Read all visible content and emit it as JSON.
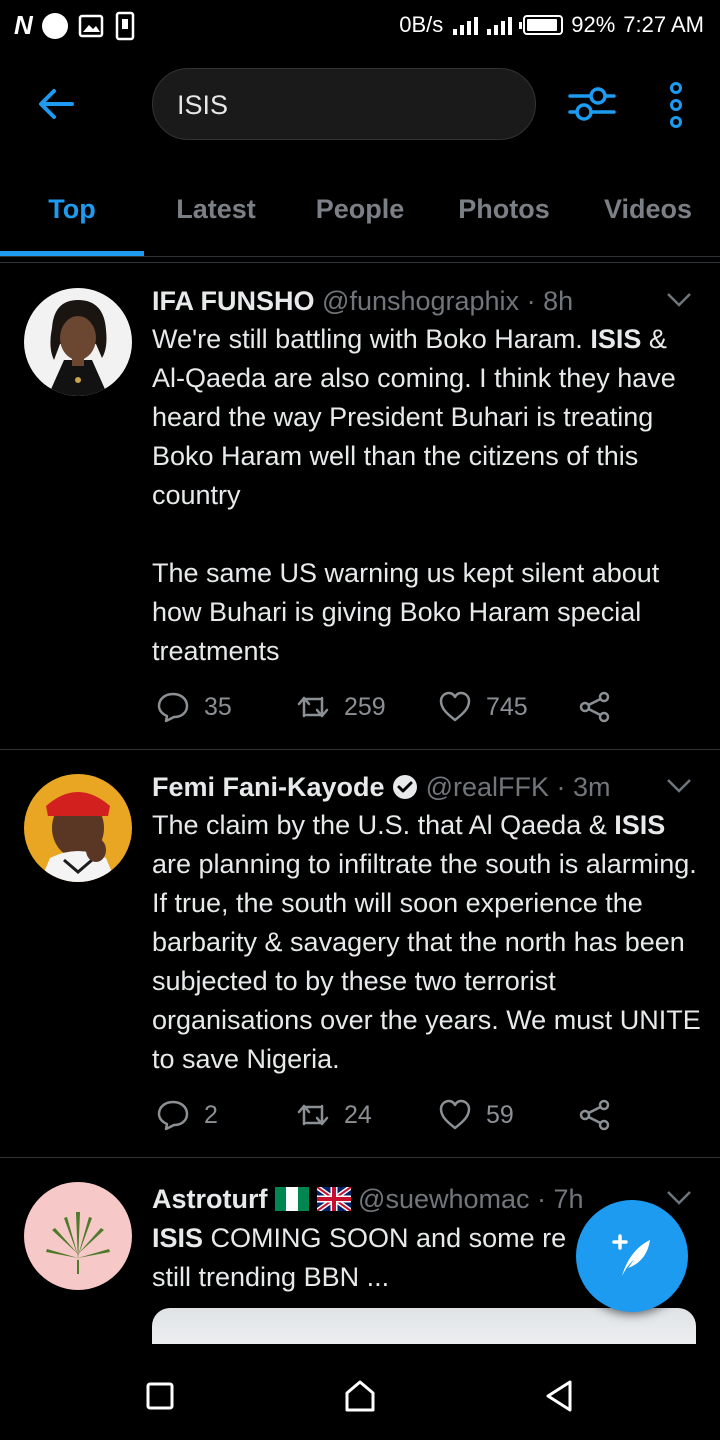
{
  "status_bar": {
    "net_speed": "0B/s",
    "battery": "92%",
    "time": "7:27 AM"
  },
  "search": {
    "query": "ISIS"
  },
  "tabs": [
    {
      "label": "Top",
      "active": true
    },
    {
      "label": "Latest",
      "active": false
    },
    {
      "label": "People",
      "active": false
    },
    {
      "label": "Photos",
      "active": false
    },
    {
      "label": "Videos",
      "active": false
    }
  ],
  "tweets": [
    {
      "name": "IFA FUNSHO",
      "handle": "@funshographix",
      "time": "· 8h",
      "body": [
        [
          "We're still battling with Boko Haram. ",
          "ISIS",
          " & Al-Qaeda are also coming. I think they have heard the way President Buhari is treating Boko Haram well than the citizens of this country"
        ],
        [
          "The same US warning us kept silent about how Buhari is giving Boko Haram special treatments"
        ]
      ],
      "replies": "35",
      "retweets": "259",
      "likes": "745"
    },
    {
      "name": "Femi Fani-Kayode",
      "verified": true,
      "handle": "@realFFK",
      "time": "· 3m",
      "body": [
        [
          "The claim by the U.S. that Al Qaeda & ",
          "ISIS",
          " are planning to infiltrate  the south is alarming. If true, the south will soon experience the barbarity & savagery that the north has been subjected to by these two terrorist organisations over the years. We must UNITE to save Nigeria."
        ]
      ],
      "replies": "2",
      "retweets": "24",
      "likes": "59"
    },
    {
      "name": "Astroturf",
      "handle": "@suewhomac",
      "time": "· 7h",
      "body": [
        [
          "",
          "ISIS",
          " COMING SOON and some re",
          "still trending BBN ..."
        ]
      ]
    }
  ],
  "colors": {
    "accent": "#1d9bf0",
    "background": "#000000",
    "muted": "#71767b"
  }
}
